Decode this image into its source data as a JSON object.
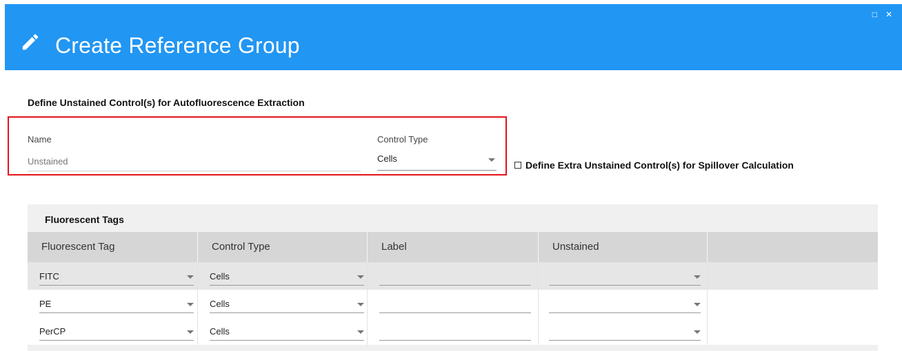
{
  "window": {
    "title": "Create Reference Group",
    "controls": {
      "maximize": "□",
      "close": "✕"
    },
    "title_icon": "pencil-icon",
    "header_color": "#2196f3"
  },
  "autofluorescence": {
    "heading": "Define Unstained Control(s) for Autofluorescence Extraction",
    "name_label": "Name",
    "name_placeholder": "Unstained",
    "name_value": "",
    "control_type_label": "Control Type",
    "control_type_value": "Cells",
    "highlight_color": "#e3121b"
  },
  "spillover": {
    "checkbox_label": "Define Extra Unstained Control(s) for Spillover Calculation",
    "checked": false
  },
  "fluorescent_tags": {
    "title": "Fluorescent Tags",
    "columns": [
      "Fluorescent Tag",
      "Control Type",
      "Label",
      "Unstained",
      ""
    ],
    "rows": [
      {
        "tag": "FITC",
        "control_type": "Cells",
        "label": "",
        "unstained": ""
      },
      {
        "tag": "PE",
        "control_type": "Cells",
        "label": "",
        "unstained": ""
      },
      {
        "tag": "PerCP",
        "control_type": "Cells",
        "label": "",
        "unstained": ""
      }
    ]
  }
}
